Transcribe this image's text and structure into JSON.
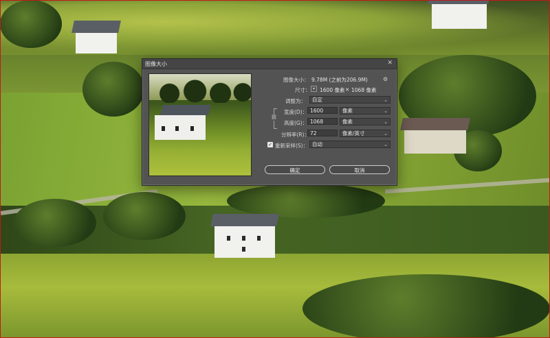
{
  "dialog": {
    "title": "图像大小",
    "close_glyph": "✕",
    "image_size_label": "图像大小：",
    "image_size_value": "9.78M (之前为206.9M)",
    "dimensions_label": "尺寸：",
    "dimensions_width": "1600 像素",
    "dimensions_sep": "×",
    "dimensions_height": "1068 像素",
    "fit_label": "调整为：",
    "fit_value": "自定",
    "width_label": "宽度(D)：",
    "width_value": "1600",
    "width_unit": "像素",
    "height_label": "高度(G)：",
    "height_value": "1068",
    "height_unit": "像素",
    "resolution_label": "分辨率(R)：",
    "resolution_value": "72",
    "resolution_unit": "像素/英寸",
    "resample_label": "重新采样(S)：",
    "resample_checked": true,
    "resample_value": "自动",
    "ok_label": "确定",
    "cancel_label": "取消"
  },
  "icons": {
    "gear": "gear-icon",
    "dropdown": "chevron-down-icon",
    "link": "chain-link-icon",
    "check": "checkmark-icon"
  }
}
